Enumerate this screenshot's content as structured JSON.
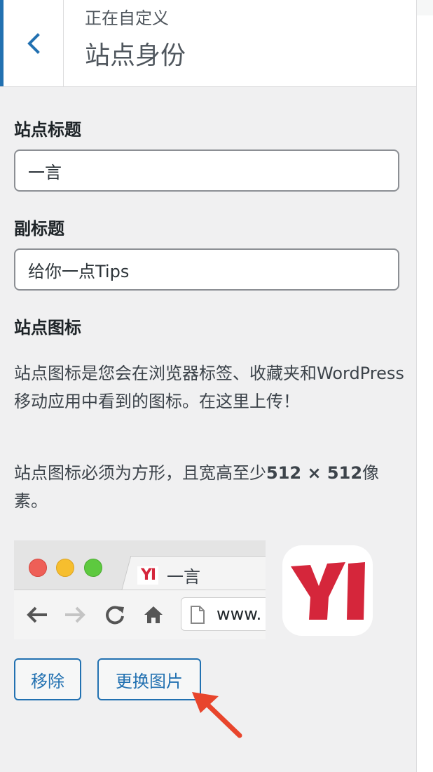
{
  "header": {
    "subtitle": "正在自定义",
    "title": "站点身份"
  },
  "site_title": {
    "label": "站点标题",
    "value": "一言"
  },
  "tagline": {
    "label": "副标题",
    "value": "给你一点Tips"
  },
  "site_icon": {
    "label": "站点图标",
    "description": "站点图标是您会在浏览器标签、收藏夹和WordPress移动应用中看到的图标。在这里上传！",
    "requirement_prefix": "站点图标必须为方形，且宽高至少",
    "requirement_size": "512 × 512",
    "requirement_suffix": "像素。",
    "preview": {
      "tab_favicon_text": "YI",
      "tab_title": "一言",
      "url_text": "www.",
      "app_icon_text": "YI"
    },
    "remove_label": "移除",
    "change_label": "更换图片"
  },
  "colors": {
    "accent": "#2271b1",
    "brand_red": "#d5263b",
    "annotation_arrow": "#e8452c"
  },
  "icons": {
    "back": "chevron-left-icon",
    "browser_back": "arrow-left-icon",
    "browser_forward": "arrow-right-icon",
    "reload": "reload-icon",
    "home": "home-icon",
    "page": "document-icon"
  }
}
